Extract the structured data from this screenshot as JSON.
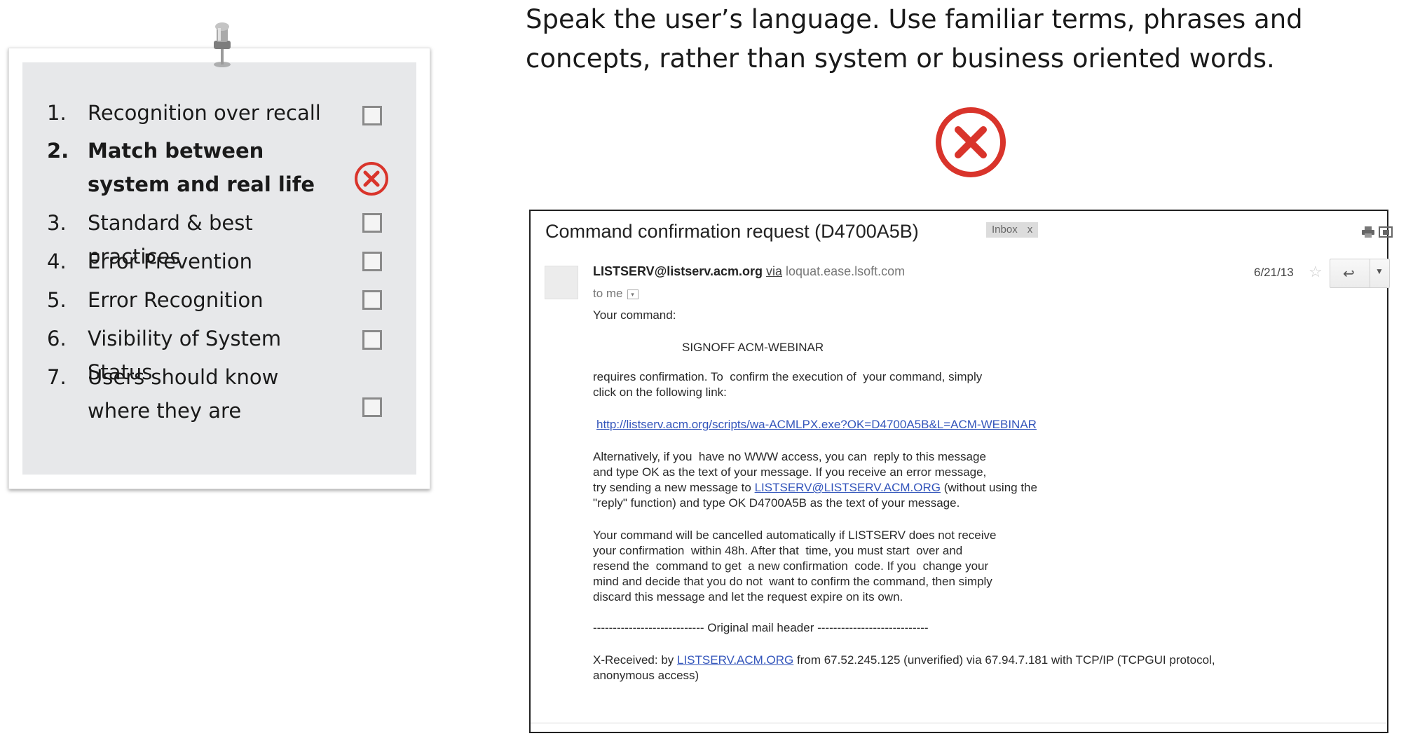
{
  "heading": "Speak the user’s language. Use familiar terms, phrases and concepts, rather than system or business oriented words.",
  "checklist": {
    "items": [
      {
        "num": "1.",
        "text": "Recognition over recall",
        "state": "unchecked"
      },
      {
        "num": "2.",
        "text": "Match between system and real life",
        "state": "failed"
      },
      {
        "num": "3.",
        "text": "Standard & best practices",
        "state": "unchecked"
      },
      {
        "num": "4.",
        "text": "Error Prevention",
        "state": "unchecked"
      },
      {
        "num": "5.",
        "text": "Error Recognition",
        "state": "unchecked"
      },
      {
        "num": "6.",
        "text": "Visibility of System Status",
        "state": "unchecked"
      },
      {
        "num": "7.",
        "text": "Users should know where they are",
        "state": "unchecked"
      }
    ]
  },
  "icons": {
    "pin": "pushpin-icon",
    "fail": "x-circle-icon",
    "checkbox": "checkbox-icon",
    "print": "print-icon",
    "newwindow": "new-window-icon",
    "reply": "reply-icon",
    "star": "star-icon"
  },
  "colors": {
    "fail_red": "#d9342b",
    "card_bg": "#e7e8ea",
    "link_blue": "#3355bb"
  },
  "email": {
    "subject": "Command confirmation request (D4700A5B)",
    "label": "Inbox",
    "label_close": "x",
    "sender": "LISTSERV@listserv.acm.org",
    "via": "via",
    "server": "loquat.ease.lsoft.com",
    "to": "to me",
    "date": "6/21/13",
    "body": {
      "line1": "Your command:",
      "command": "SIGNOFF ACM-WEBINAR",
      "para1a": "requires confirmation. To  confirm the execution of  your command, simply",
      "para1b": "click on the following link:",
      "link": "http://listserv.acm.org/scripts/wa-ACMLPX.exe?OK=D4700A5B&L=ACM-WEBINAR",
      "para2a": "Alternatively, if you  have no WWW access, you can  reply to this message",
      "para2b": "and type OK as the text of your message. If you receive an error message,",
      "para2c_pre": "try sending a new message to ",
      "para2c_link": "LISTSERV@LISTSERV.ACM.ORG",
      "para2c_post": " (without using the",
      "para2d": "\"reply\" function) and type OK D4700A5B as the text of your message.",
      "para3a": "Your command will be cancelled automatically if LISTSERV does not receive",
      "para3b": "your confirmation  within 48h. After that  time, you must start  over and",
      "para3c": "resend the  command to get  a new confirmation  code. If you  change your",
      "para3d": "mind and decide that you do not  want to confirm the command, then simply",
      "para3e": "discard this message and let the request expire on its own.",
      "divider": "---------------------------- Original mail header ----------------------------",
      "xrec_pre": "X-Received: by ",
      "xrec_link": "LISTSERV.ACM.ORG",
      "xrec_post": " from 67.52.245.125 (unverified) via 67.94.7.181 with TCP/IP (TCPGUI protocol,",
      "xrec_b": "anonymous access)"
    }
  }
}
